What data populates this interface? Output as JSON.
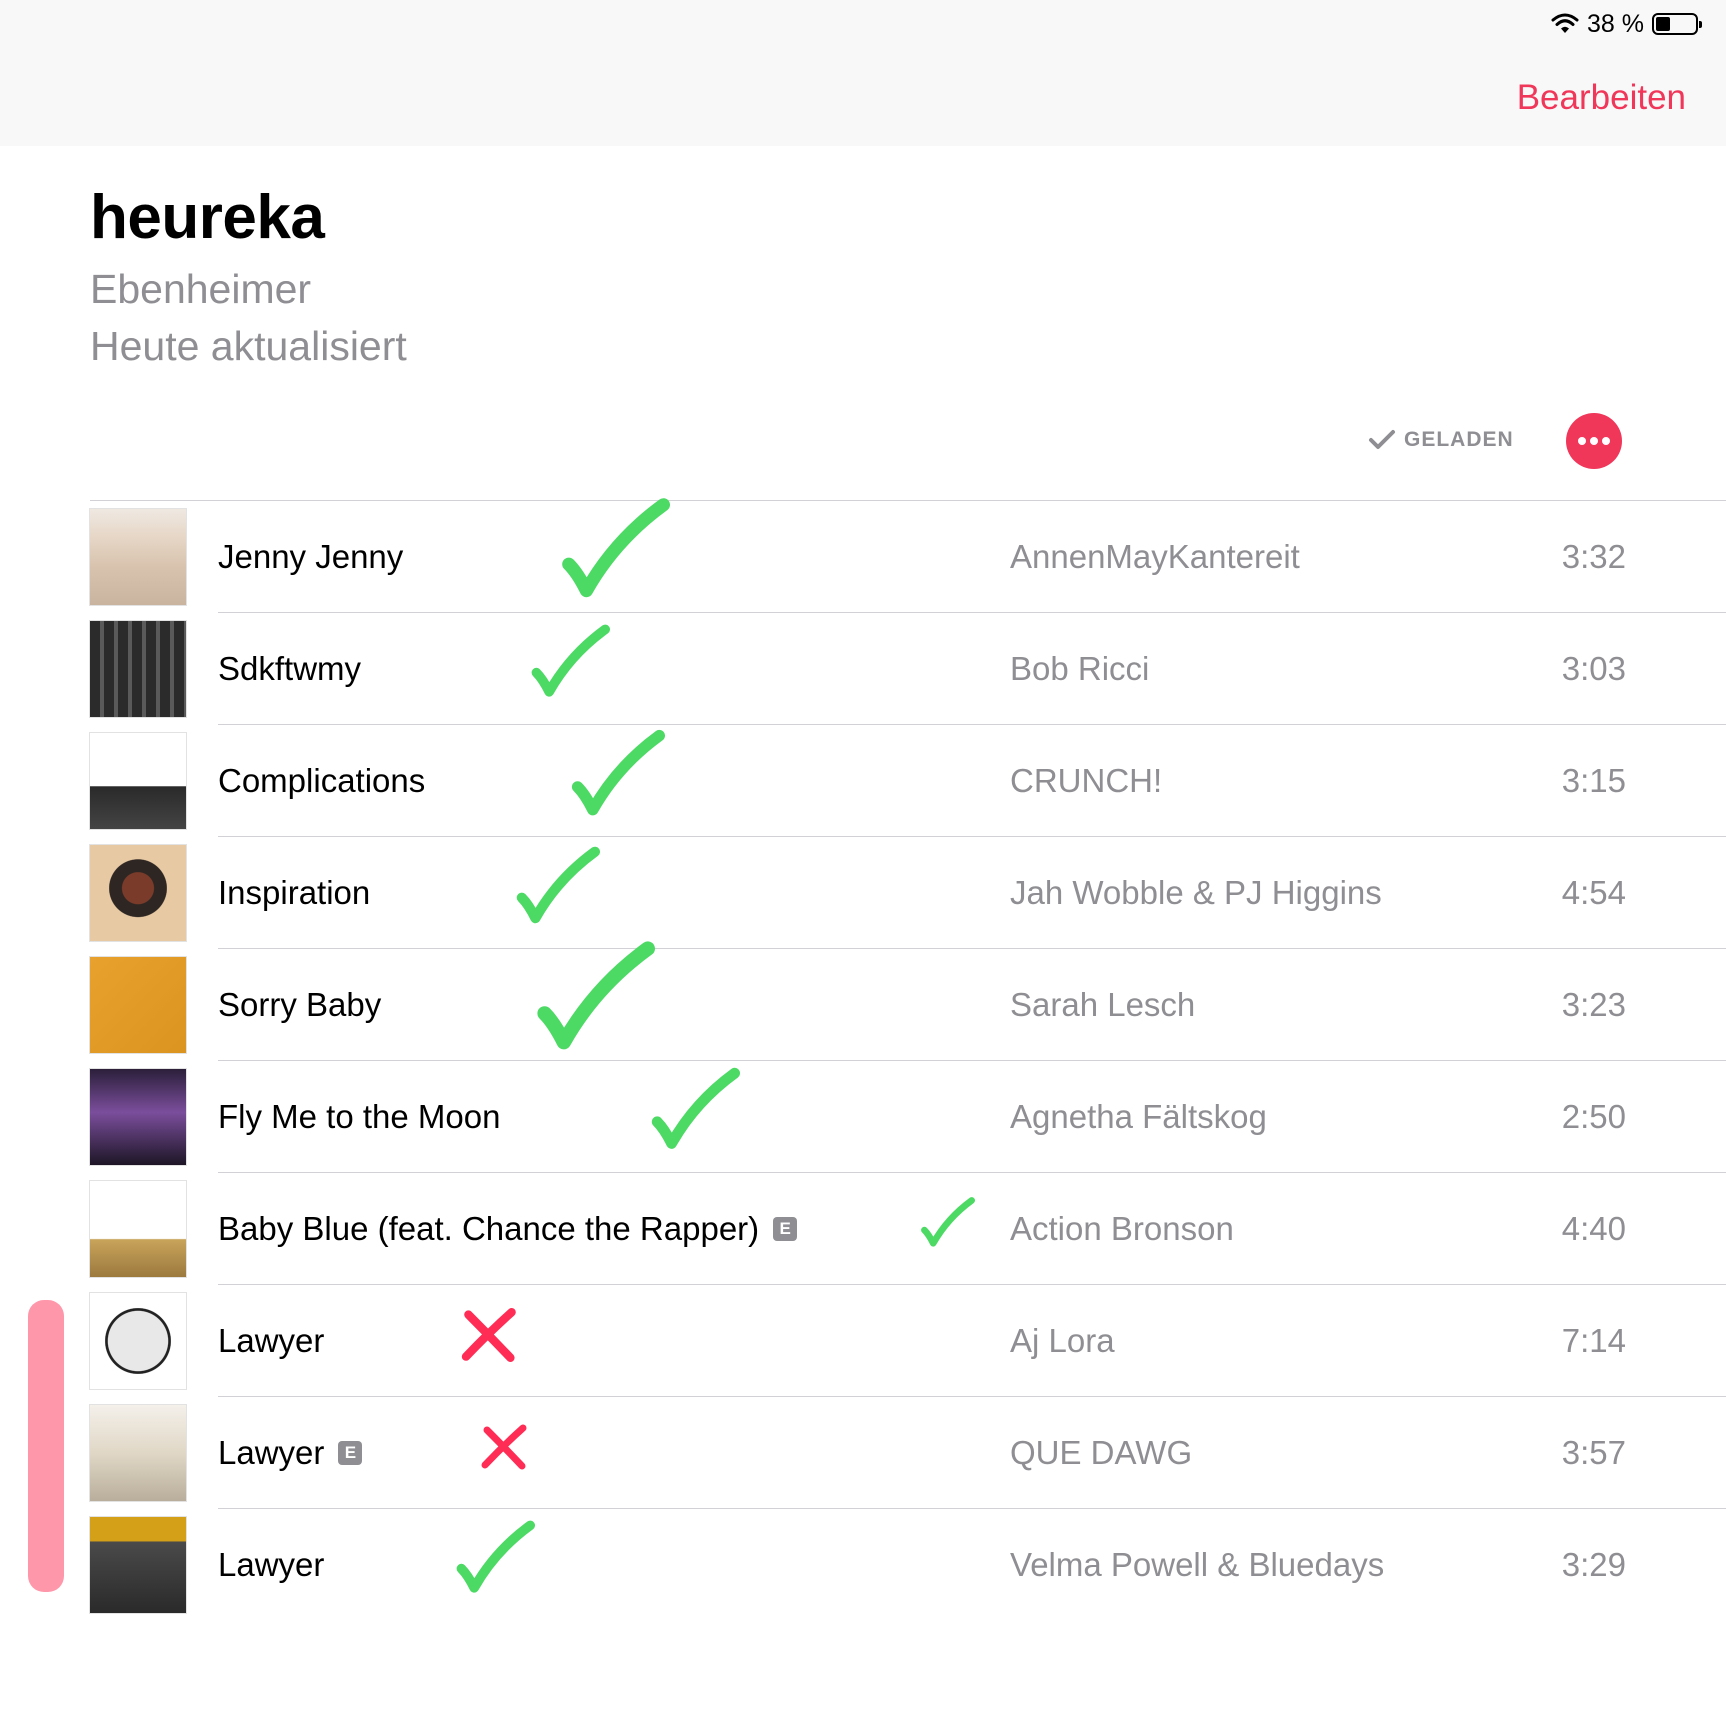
{
  "status_bar": {
    "battery_text": "38 %",
    "battery_level": 0.38,
    "wifi_icon": "wifi-icon"
  },
  "nav": {
    "edit_label": "Bearbeiten"
  },
  "playlist": {
    "title": "heureka",
    "curator": "Ebenheimer",
    "updated": "Heute aktualisiert"
  },
  "actions": {
    "downloaded_label": "GELADEN",
    "more_icon": "more-icon"
  },
  "colors": {
    "accent": "#f0375a",
    "secondary_text": "#8e8e93",
    "check_mark": "#4cd964",
    "cross_mark": "#ff2d55",
    "highlighter": "#ff7d96"
  },
  "tracks": [
    {
      "title": "Jenny Jenny",
      "explicit": false,
      "artist": "AnnenMayKantereit",
      "duration": "3:32",
      "annotation": "check"
    },
    {
      "title": "Sdkftwmy",
      "explicit": false,
      "artist": "Bob Ricci",
      "duration": "3:03",
      "annotation": "check"
    },
    {
      "title": "Complications",
      "explicit": false,
      "artist": "CRUNCH!",
      "duration": "3:15",
      "annotation": "check"
    },
    {
      "title": "Inspiration",
      "explicit": false,
      "artist": "Jah Wobble & PJ Higgins",
      "duration": "4:54",
      "annotation": "check"
    },
    {
      "title": "Sorry Baby",
      "explicit": false,
      "artist": "Sarah Lesch",
      "duration": "3:23",
      "annotation": "check"
    },
    {
      "title": "Fly Me to the Moon",
      "explicit": false,
      "artist": "Agnetha Fältskog",
      "duration": "2:50",
      "annotation": "check"
    },
    {
      "title": "Baby Blue (feat. Chance the Rapper)",
      "explicit": true,
      "explicit_label": "E",
      "artist": "Action Bronson",
      "duration": "4:40",
      "annotation": "check"
    },
    {
      "title": "Lawyer",
      "explicit": false,
      "artist": "Aj Lora",
      "duration": "7:14",
      "annotation": "cross"
    },
    {
      "title": "Lawyer",
      "explicit": true,
      "explicit_label": "E",
      "artist": "QUE DAWG",
      "duration": "3:57",
      "annotation": "cross"
    },
    {
      "title": "Lawyer",
      "explicit": false,
      "artist": "Velma Powell & Bluedays",
      "duration": "3:29",
      "annotation": "check"
    }
  ]
}
